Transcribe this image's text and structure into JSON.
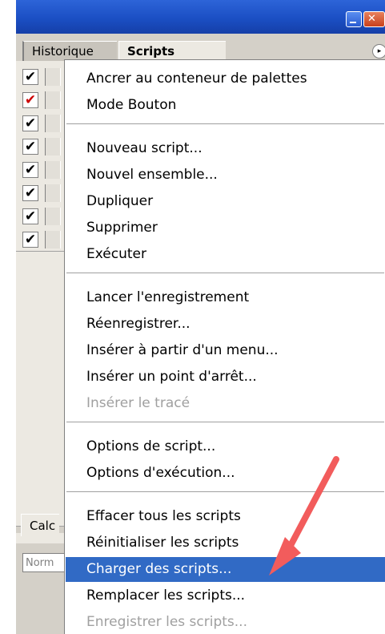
{
  "palette": {
    "tabs": [
      "Historique",
      "Scripts"
    ],
    "active_tab": "Scripts",
    "rows": [
      {
        "checked": true,
        "color": "#000000"
      },
      {
        "checked": true,
        "color": "#cc0000"
      },
      {
        "checked": true,
        "color": "#000000"
      },
      {
        "checked": true,
        "color": "#000000"
      },
      {
        "checked": true,
        "color": "#000000"
      },
      {
        "checked": true,
        "color": "#000000"
      },
      {
        "checked": true,
        "color": "#000000"
      },
      {
        "checked": true,
        "color": "#000000"
      }
    ],
    "lower_tab": "Calc",
    "blend_mode": "Norm"
  },
  "menu": {
    "groups": [
      [
        "Ancrer au conteneur de palettes",
        "Mode Bouton"
      ],
      [
        "Nouveau script...",
        "Nouvel ensemble...",
        "Dupliquer",
        "Supprimer",
        "Exécuter"
      ],
      [
        "Lancer l'enregistrement",
        "Réenregistrer...",
        "Insérer à partir d'un menu...",
        "Insérer un point d'arrêt...",
        "Insérer le tracé"
      ],
      [
        "Options de script...",
        "Options d'exécution..."
      ],
      [
        "Effacer tous les scripts",
        "Réinitialiser les scripts",
        "Charger des scripts...",
        "Remplacer les scripts...",
        "Enregistrer les scripts..."
      ]
    ],
    "disabled": [
      "Insérer le tracé",
      "Enregistrer les scripts..."
    ],
    "highlighted": "Charger des scripts..."
  },
  "colors": {
    "highlight": "#316ac5",
    "arrow": "#f25c5c",
    "title_bar": "#1b4fc4"
  }
}
